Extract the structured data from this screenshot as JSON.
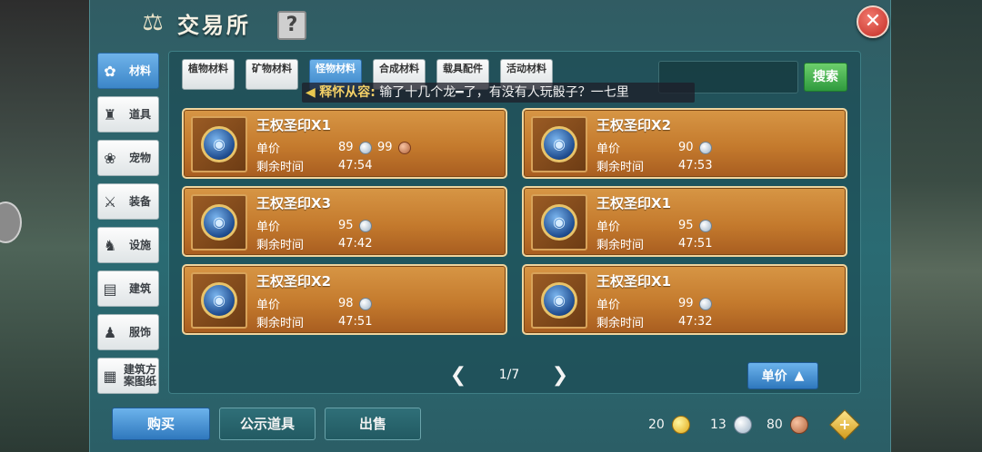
{
  "header": {
    "title": "交易所",
    "help_label": "?",
    "close_label": "✕"
  },
  "sidebar": [
    {
      "label": "材料",
      "icon": "✿",
      "icon_name": "materials-icon",
      "active": true
    },
    {
      "label": "道具",
      "icon": "♜",
      "icon_name": "items-icon",
      "active": false
    },
    {
      "label": "宠物",
      "icon": "❀",
      "icon_name": "paw-icon",
      "active": false
    },
    {
      "label": "装备",
      "icon": "⚔",
      "icon_name": "equipment-icon",
      "active": false
    },
    {
      "label": "设施",
      "icon": "♞",
      "icon_name": "facility-icon",
      "active": false
    },
    {
      "label": "建筑",
      "icon": "▤",
      "icon_name": "building-icon",
      "active": false
    },
    {
      "label": "服饰",
      "icon": "♟",
      "icon_name": "clothing-icon",
      "active": false
    },
    {
      "label": "建筑方案图纸",
      "icon": "▦",
      "icon_name": "blueprint-icon",
      "active": false
    }
  ],
  "tabs": [
    {
      "label": "植物材料",
      "active": false
    },
    {
      "label": "矿物材料",
      "active": false
    },
    {
      "label": "怪物材料",
      "active": true
    },
    {
      "label": "合成材料",
      "active": false
    },
    {
      "label": "载具配件",
      "active": false
    },
    {
      "label": "活动材料",
      "active": false
    }
  ],
  "search": {
    "button_label": "搜索",
    "value": ""
  },
  "chat": {
    "sender": "释怀从容:",
    "message": "输了十几个龙━了，有没有人玩骰子？一七里"
  },
  "listing_labels": {
    "price": "单价",
    "time": "剩余时间"
  },
  "listings": [
    {
      "name": "王权圣印X1",
      "silver": "89",
      "copper": "99",
      "time": "47:54"
    },
    {
      "name": "王权圣印X2",
      "silver": "90",
      "copper": "",
      "time": "47:53"
    },
    {
      "name": "王权圣印X3",
      "silver": "95",
      "copper": "",
      "time": "47:42"
    },
    {
      "name": "王权圣印X1",
      "silver": "95",
      "copper": "",
      "time": "47:51"
    },
    {
      "name": "王权圣印X2",
      "silver": "98",
      "copper": "",
      "time": "47:51"
    },
    {
      "name": "王权圣印X1",
      "silver": "99",
      "copper": "",
      "time": "47:32"
    }
  ],
  "pager": {
    "page": "1/7"
  },
  "sort": {
    "label": "单价"
  },
  "bottom": {
    "buy": "购买",
    "public": "公示道具",
    "sell": "出售"
  },
  "currency": {
    "gold": "20",
    "silver": "13",
    "copper": "80"
  },
  "colors": {
    "accent_blue": "#3c86c8",
    "card_orange": "#c47a2d",
    "search_green": "#2f9a3e",
    "close_red": "#c22c25"
  }
}
